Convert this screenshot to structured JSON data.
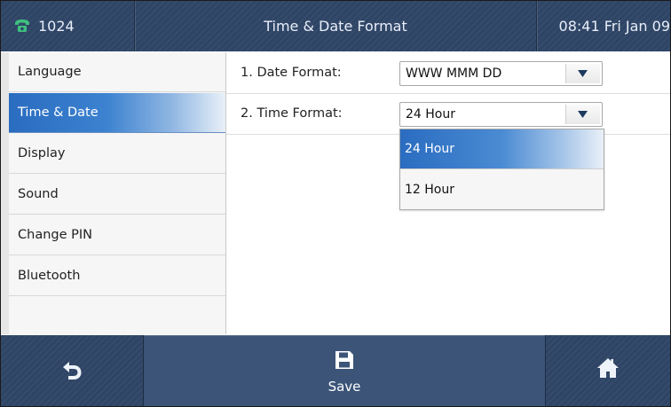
{
  "header": {
    "account": "1024",
    "title": "Time & Date Format",
    "clock": "08:41 Fri Jan 09"
  },
  "sidebar": {
    "items": [
      {
        "label": "Language"
      },
      {
        "label": "Time & Date",
        "selected": true
      },
      {
        "label": "Display"
      },
      {
        "label": "Sound"
      },
      {
        "label": "Change PIN"
      },
      {
        "label": "Bluetooth"
      }
    ]
  },
  "settings": {
    "date_format": {
      "label": "1. Date Format:",
      "value": "WWW MMM DD"
    },
    "time_format": {
      "label": "2. Time Format:",
      "value": "24 Hour"
    }
  },
  "dropdown": {
    "options": [
      {
        "label": "24 Hour",
        "selected": true
      },
      {
        "label": "12 Hour"
      }
    ]
  },
  "softkeys": {
    "back_icon": "back-arrow-icon",
    "save_label": "Save",
    "save_icon": "floppy-disk-icon",
    "home_icon": "home-icon"
  },
  "colors": {
    "bar": "#2f4566",
    "accent": "#2a6cc0",
    "phone_icon": "#3fbf7f"
  }
}
